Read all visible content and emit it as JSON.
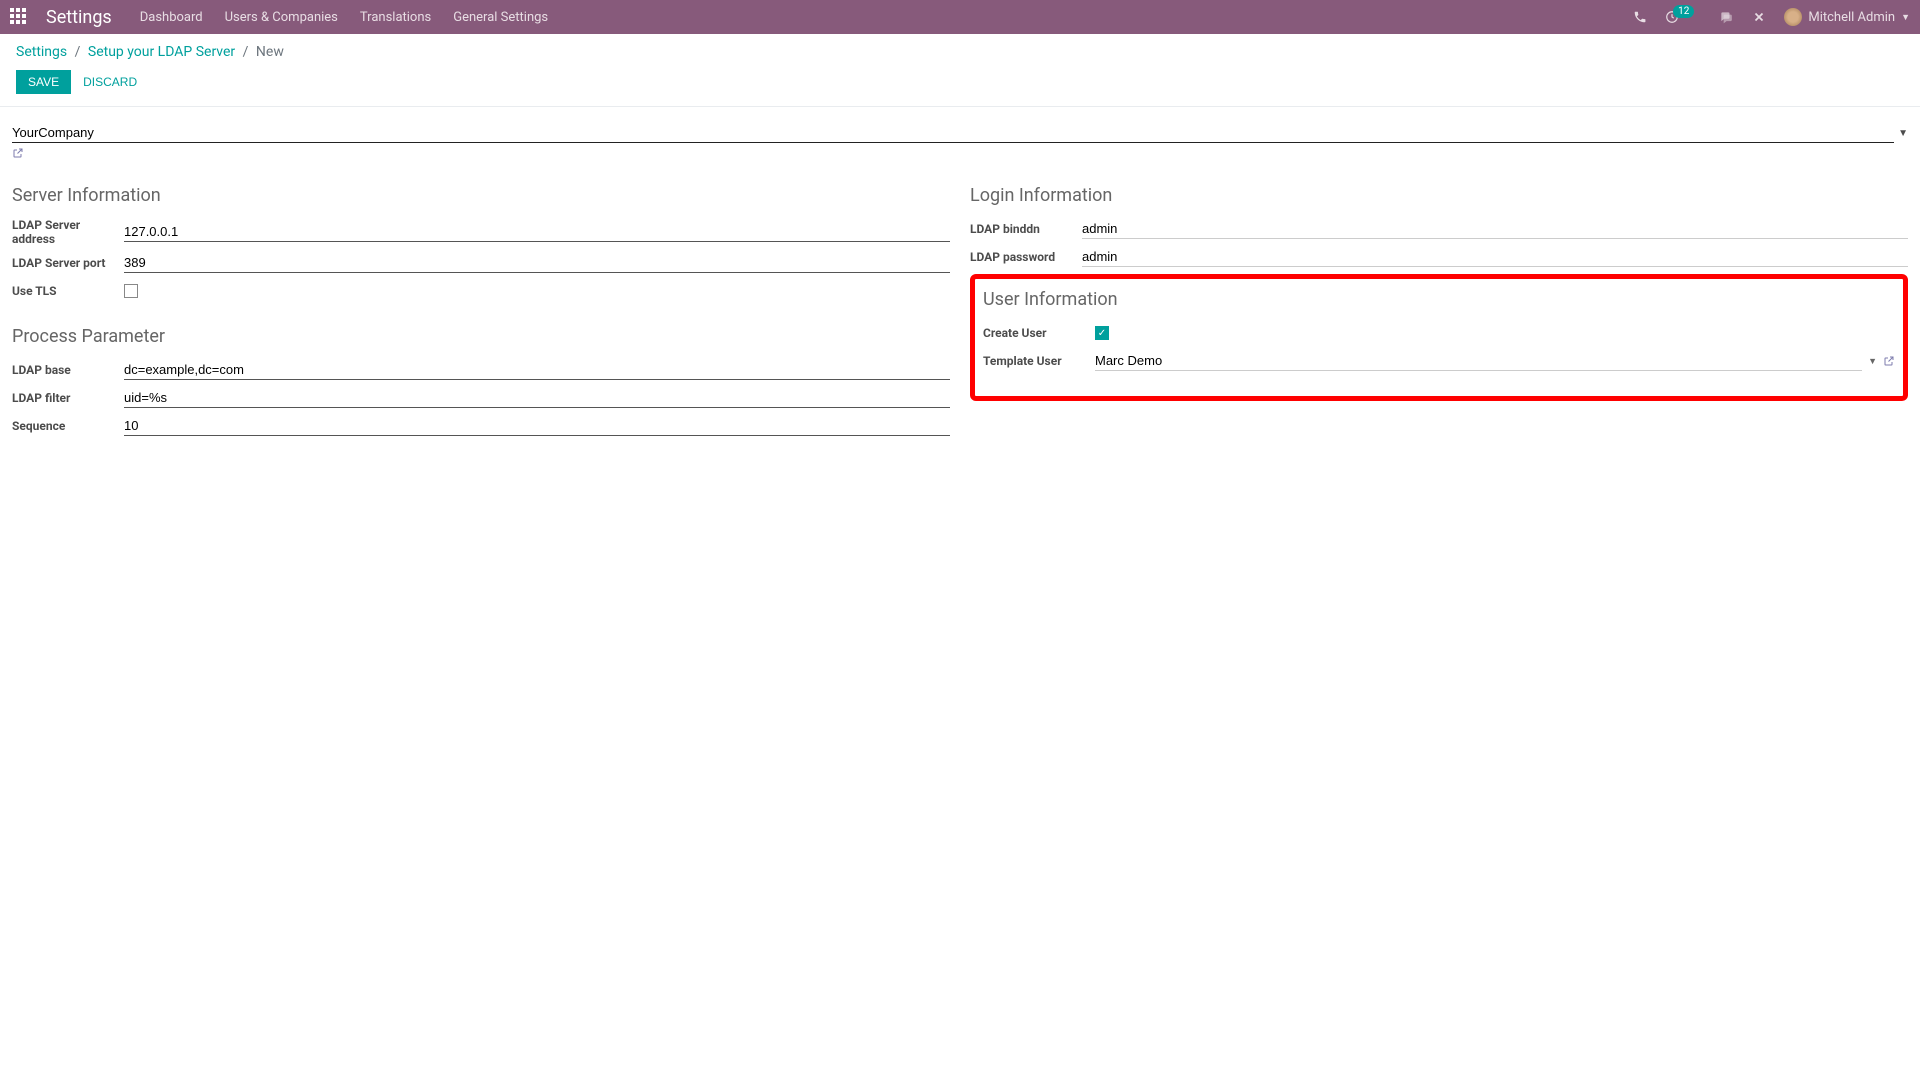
{
  "topbar": {
    "title": "Settings",
    "menu": [
      "Dashboard",
      "Users & Companies",
      "Translations",
      "General Settings"
    ],
    "badge_count": "12",
    "user_name": "Mitchell Admin"
  },
  "breadcrumb": {
    "items": [
      "Settings",
      "Setup your LDAP Server"
    ],
    "current": "New"
  },
  "buttons": {
    "save": "Save",
    "discard": "Discard"
  },
  "form": {
    "company": "YourCompany",
    "server_info": {
      "title": "Server Information",
      "address_label": "LDAP Server address",
      "address_value": "127.0.0.1",
      "port_label": "LDAP Server port",
      "port_value": "389",
      "tls_label": "Use TLS"
    },
    "login_info": {
      "title": "Login Information",
      "binddn_label": "LDAP binddn",
      "binddn_value": "admin",
      "password_label": "LDAP password",
      "password_value": "admin"
    },
    "process_param": {
      "title": "Process Parameter",
      "base_label": "LDAP base",
      "base_value": "dc=example,dc=com",
      "filter_label": "LDAP filter",
      "filter_value": "uid=%s",
      "sequence_label": "Sequence",
      "sequence_value": "10"
    },
    "user_info": {
      "title": "User Information",
      "create_user_label": "Create User",
      "template_user_label": "Template User",
      "template_user_value": "Marc Demo"
    }
  }
}
